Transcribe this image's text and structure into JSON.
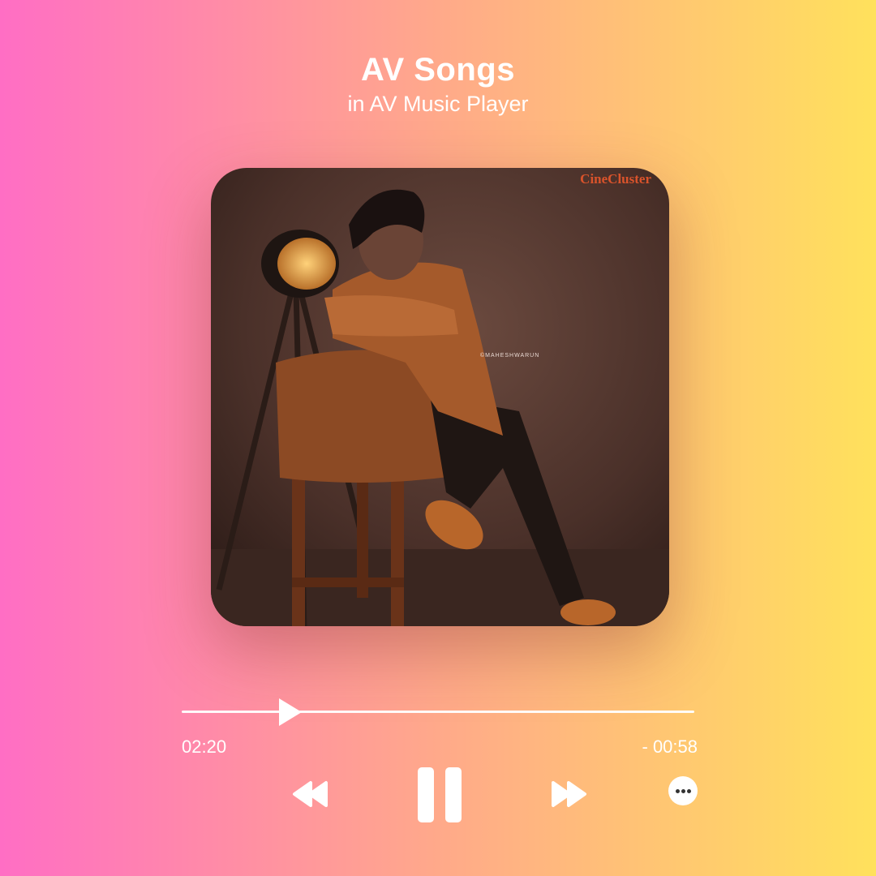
{
  "header": {
    "title": "AV Songs",
    "subtitle": "in AV Music Player"
  },
  "artwork": {
    "watermark": "CineCluster",
    "photo_credit": "©MAHESHWARUN"
  },
  "player": {
    "elapsed": "02:20",
    "remaining": "- 00:58",
    "progress_fraction": 0.2
  },
  "colors": {
    "gradient_left": "#ff6ec4",
    "gradient_mid": "#ffa98a",
    "gradient_right": "#ffe15c",
    "controls": "#ffffff"
  },
  "icons": {
    "previous": "rewind-icon",
    "pause": "pause-icon",
    "next": "fast-forward-icon",
    "more": "more-options-icon"
  }
}
